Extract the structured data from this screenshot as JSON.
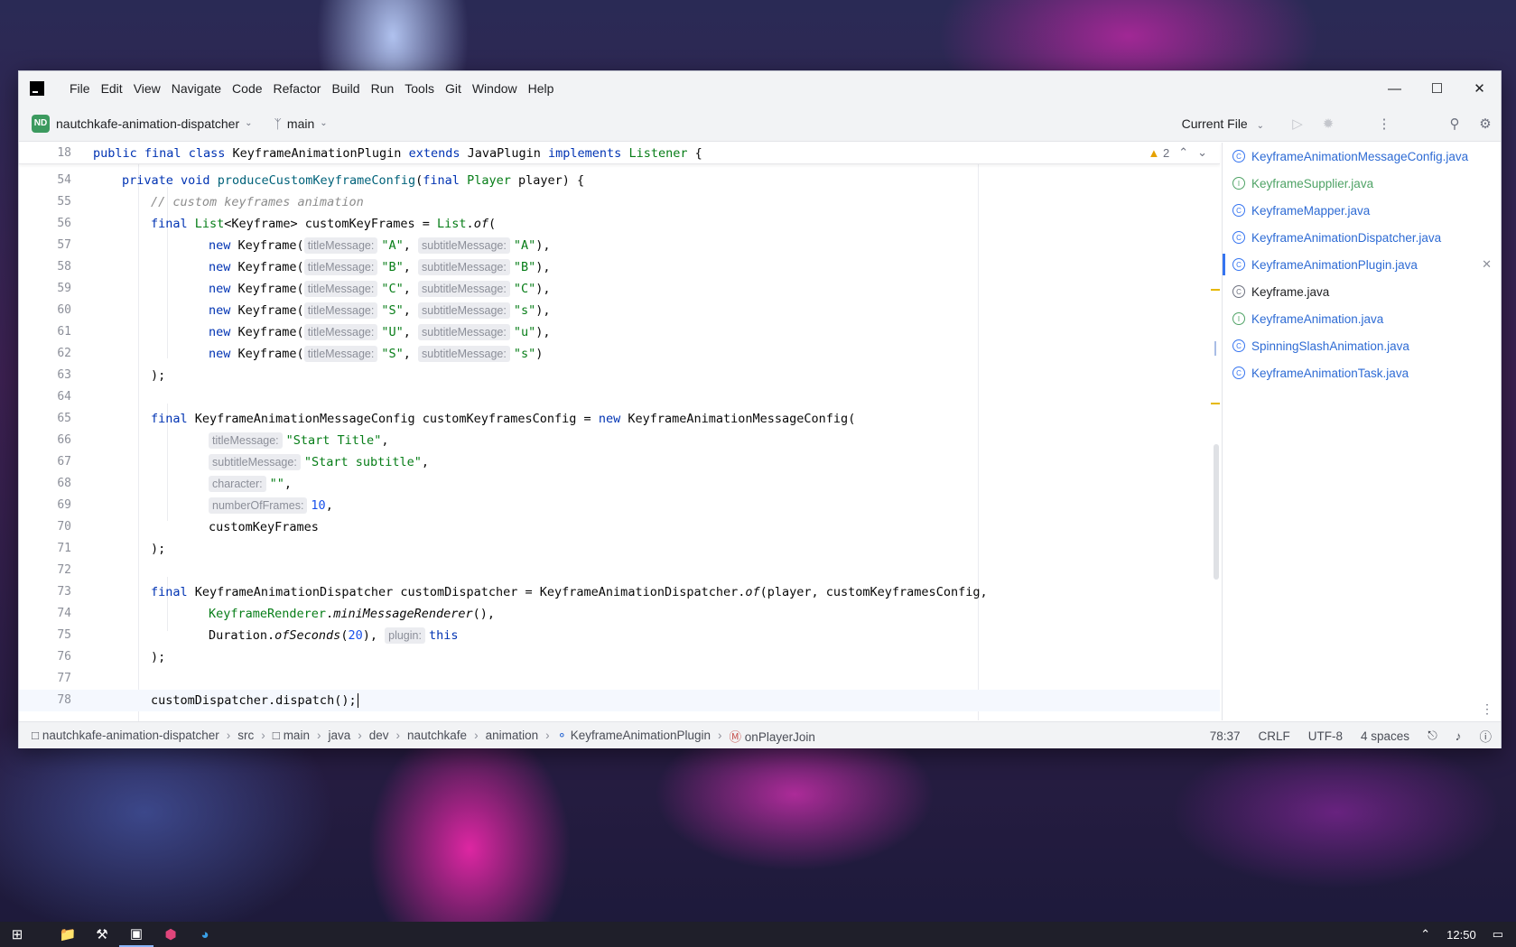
{
  "menu": [
    "File",
    "Edit",
    "View",
    "Navigate",
    "Code",
    "Refactor",
    "Build",
    "Run",
    "Tools",
    "Git",
    "Window",
    "Help"
  ],
  "toolbar": {
    "project_badge": "ND",
    "project_name": "nautchkafe-animation-dispatcher",
    "branch": "main",
    "run_config": "Current File"
  },
  "editor": {
    "sticky_line_number": "18",
    "warnings_count": "2",
    "lines": [
      {
        "n": "54"
      },
      {
        "n": "55"
      },
      {
        "n": "56"
      },
      {
        "n": "57"
      },
      {
        "n": "58"
      },
      {
        "n": "59"
      },
      {
        "n": "60"
      },
      {
        "n": "61"
      },
      {
        "n": "62"
      },
      {
        "n": "63"
      },
      {
        "n": "64"
      },
      {
        "n": "65"
      },
      {
        "n": "66"
      },
      {
        "n": "67"
      },
      {
        "n": "68"
      },
      {
        "n": "69"
      },
      {
        "n": "70"
      },
      {
        "n": "71"
      },
      {
        "n": "72"
      },
      {
        "n": "73"
      },
      {
        "n": "74"
      },
      {
        "n": "75"
      },
      {
        "n": "76"
      },
      {
        "n": "77"
      },
      {
        "n": "78"
      }
    ],
    "code": {
      "sticky": {
        "public": "public",
        "final": "final",
        "class": "class",
        "classname": "KeyframeAnimationPlugin",
        "extends": "extends",
        "super": "JavaPlugin",
        "implements": "implements",
        "iface": "Listener",
        "brace": "{"
      },
      "l54": {
        "private": "private",
        "void": "void",
        "fn": "produceCustomKeyframeConfig",
        "open": "(",
        "final": "final",
        "type": "Player",
        "rest": "player) {"
      },
      "l55": "// custom keyframes animation",
      "l56": {
        "final": "final",
        "type": "List",
        "generic": "<Keyframe>",
        "rest": "customKeyFrames =",
        "cls": "List",
        "dot": ".",
        "of": "of",
        "open": "("
      },
      "keyframes": [
        {
          "title": "\"A\"",
          "subtitle": "\"A\"",
          "end": "),"
        },
        {
          "title": "\"B\"",
          "subtitle": "\"B\"",
          "end": "),"
        },
        {
          "title": "\"C\"",
          "subtitle": "\"C\"",
          "end": "),"
        },
        {
          "title": "\"S\"",
          "subtitle": "\"s\"",
          "end": "),"
        },
        {
          "title": "\"U\"",
          "subtitle": "\"u\"",
          "end": "),"
        },
        {
          "title": "\"S\"",
          "subtitle": "\"s\"",
          "end": ")"
        }
      ],
      "kf_new": "new",
      "kf_ctor": "Keyframe(",
      "kf_comma": ",",
      "hint_title": "titleMessage:",
      "hint_subtitle": "subtitleMessage:",
      "close_paren": ");",
      "l65": {
        "final": "final",
        "rest": "KeyframeAnimationMessageConfig customKeyframesConfig =",
        "new": "new",
        "ctor": "KeyframeAnimationMessageConfig("
      },
      "l66": {
        "hint": "titleMessage:",
        "val": "\"Start Title\"",
        "comma": ","
      },
      "l67": {
        "hint": "subtitleMessage:",
        "val": "\"Start subtitle\"",
        "comma": ","
      },
      "l68": {
        "hint": "character:",
        "val": "\"\"",
        "comma": ","
      },
      "l69": {
        "hint": "numberOfFrames:",
        "val": "10",
        "comma": ","
      },
      "l70": "customKeyFrames",
      "l73": {
        "final": "final",
        "rest": "KeyframeAnimationDispatcher customDispatcher = KeyframeAnimationDispatcher.",
        "of": "of",
        "args": "(player, customKeyframesConfig,"
      },
      "l74": {
        "cls": "KeyframeRenderer",
        "dot": ".",
        "fn": "miniMessageRenderer",
        "rest": "(),"
      },
      "l75": {
        "cls": "Duration.",
        "fn": "ofSeconds",
        "open": "(",
        "num": "20",
        "rest": "),",
        "hint": "plugin:",
        "kw": "this"
      },
      "l78": "customDispatcher.dispatch();"
    }
  },
  "files": [
    {
      "name": "KeyframeAnimationMessageConfig.java",
      "kind": "class"
    },
    {
      "name": "KeyframeSupplier.java",
      "kind": "interface"
    },
    {
      "name": "KeyframeMapper.java",
      "kind": "class"
    },
    {
      "name": "KeyframeAnimationDispatcher.java",
      "kind": "class"
    },
    {
      "name": "KeyframeAnimationPlugin.java",
      "kind": "class",
      "active": true
    },
    {
      "name": "Keyframe.java",
      "kind": "plain"
    },
    {
      "name": "KeyframeAnimation.java",
      "kind": "interface"
    },
    {
      "name": "SpinningSlashAnimation.java",
      "kind": "class"
    },
    {
      "name": "KeyframeAnimationTask.java",
      "kind": "class"
    }
  ],
  "status": {
    "breadcrumbs": [
      "nautchkafe-animation-dispatcher",
      "src",
      "main",
      "java",
      "dev",
      "nautchkafe",
      "animation",
      "KeyframeAnimationPlugin",
      "onPlayerJoin"
    ],
    "position": "78:37",
    "line_ending": "CRLF",
    "encoding": "UTF-8",
    "indent": "4 spaces"
  },
  "taskbar": {
    "time": "12:50"
  },
  "colors": {
    "keyword": "#0033b3",
    "type": "#067d17",
    "method": "#00627a",
    "string": "#067d17",
    "number": "#1750eb",
    "comment": "#8c8c8c",
    "link": "#2e6bd4"
  }
}
